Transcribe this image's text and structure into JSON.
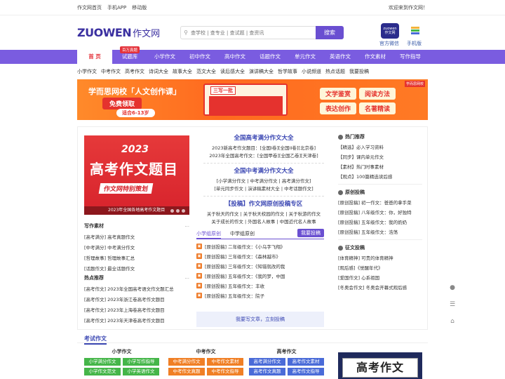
{
  "topbar": {
    "links": [
      "作文网首页",
      "手机APP",
      "移动版"
    ],
    "welcome": "欢迎来到作文网！"
  },
  "logo": {
    "en": "ZUOWEN",
    "cn": "作文网"
  },
  "search": {
    "placeholder": "查学校 | 查专业 | 查试题 | 查资讯",
    "button": "搜索"
  },
  "qr": {
    "wechat_label": "官方微信",
    "mobile_label": "手机版",
    "wechat_text": [
      "zuowen",
      "作文网"
    ]
  },
  "nav": {
    "badge": "百万真题",
    "items": [
      "首 页",
      "试题库",
      "小学作文",
      "初中作文",
      "高中作文",
      "话题作文",
      "单元作文",
      "英语作文",
      "作文素材",
      "写作指导"
    ]
  },
  "subnav": [
    "小学作文",
    "中考作文",
    "高考作文",
    "诗词大全",
    "故事大全",
    "范文大全",
    "读后感大全",
    "演讲稿大全",
    "哲学故事",
    "小说频道",
    "热点话题",
    "我要投稿"
  ],
  "banner": {
    "line1": "学而思网校「人文创作课」",
    "line2": "免费领取",
    "line3": "适合6-13岁",
    "mid_title": "三写一批",
    "tags": [
      "文学鉴赏",
      "阅读方法",
      "表达创作",
      "名著精读"
    ],
    "badge": "学而思网校"
  },
  "poster": {
    "year": "2023",
    "title": "高考作文题目",
    "subtitle": "作文网特别策划",
    "caption": "2023年全国各地高考作文题目"
  },
  "left_sections": [
    {
      "title": "写作素材",
      "more": "...",
      "rows": [
        "[高考满分] 高考真题作文",
        "[中考满分] 中考满分作文",
        "[哲理故事] 哲理故事汇总",
        "[话题作文] 最全话题作文"
      ]
    },
    {
      "title": "热点推荐",
      "more": "...",
      "rows": [
        "[高考作文] 2023年全国高考语文作文题汇总",
        "[高考作文] 2023年浙江卷高考作文题目",
        "[高考作文] 2023年上海卷高考作文题目",
        "[高考作文] 2023年天津卷高考作文题目"
      ]
    }
  ],
  "middle": [
    {
      "title": "全国高考满分作文大全",
      "lines": [
        "2023新高考作文题目：[全国I卷][全国II卷][北京卷]",
        "2023年全国高考作文：[全国甲卷][全国乙卷][天津卷]"
      ]
    },
    {
      "title": "全国中考满分作文大全",
      "lines": [
        "[小学满分作文 | 中考满分作文 | 高考满分作文]",
        "[单元同步作文 | 演讲稿素材大全 | 中考话题作文]"
      ]
    },
    {
      "title": "【投稿】作文网原创投稿专区",
      "lines": [
        "关于秋天的作文 | 关于秋天校园的作文 | 关于秋游的作文",
        "关于成长的作文 | 外国名人故事 | 中国近代名人故事"
      ]
    }
  ],
  "tabs": {
    "items": [
      "小学组原创",
      "中学组原创"
    ],
    "button": "我要投稿"
  },
  "tab_list": [
    "[原创投稿] 二年级作文：《小乌字飞翔》",
    "[原创投稿] 三年级作文：《森林越市》",
    "[原创投稿] 三年级作文：《知错就改的我",
    "[原创投稿] 五年级作文：《我的梦，中国",
    "[原创投稿] 五年级作文：丰收",
    "[原创投稿] 五年级作文：院子"
  ],
  "submit_text": "我要写文章，立刻投稿",
  "right": [
    {
      "title": "热门推荐",
      "items": [
        "【精选】必入学习资料",
        "【同步】课内单元作文",
        "【素材】热门时事素材",
        "【观点】100篇精选读后感"
      ]
    },
    {
      "title": "原创投稿",
      "items": [
        "[原创投稿] 初一作文：爸爸的拿手菜",
        "[原创投稿] 八年级作文：你，好独特",
        "[原创投稿] 五年级作文：我的奶奶",
        "[原创投稿] 五年级作文：浩荡"
      ]
    },
    {
      "title": "征文投稿",
      "items": [
        "[体育精神] 可贵的体育精神",
        "[观后感]《觉醒年代》",
        "[爱国作文] 心系祖国",
        "[冬奥会作文] 冬奥会开幕式观后感"
      ]
    }
  ],
  "exam": {
    "title": "考试作文",
    "groups": [
      {
        "title": "小学作文",
        "items": [
          "小学满分作文",
          "小学写作指导",
          "小学作文范文",
          "小学英语作文"
        ]
      },
      {
        "title": "中考作文",
        "items": [
          "中考满分作文",
          "中考作文素材",
          "中考作文真题",
          "中考作文指导"
        ]
      },
      {
        "title": "高考作文",
        "items": [
          "高考满分作文",
          "高考作文素材",
          "高考作文真题",
          "高考作文指导"
        ]
      }
    ],
    "poster_text": "高考作文"
  }
}
